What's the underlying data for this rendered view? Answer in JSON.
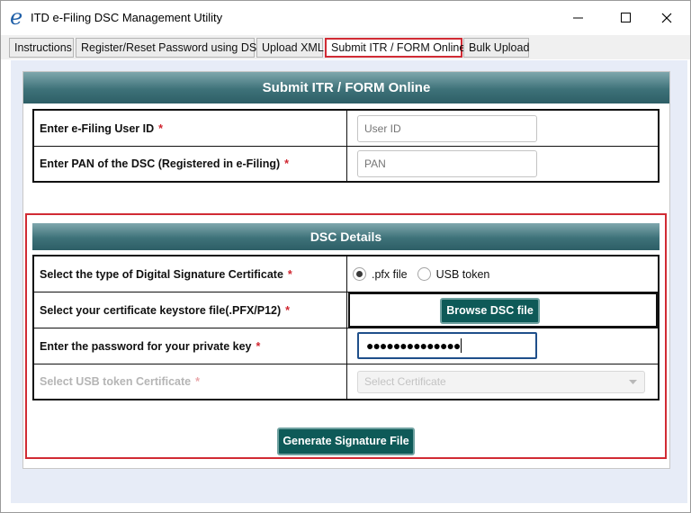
{
  "window": {
    "logo_letter": "e",
    "title": "ITD e-Filing DSC Management Utility"
  },
  "tabs": [
    {
      "label": "Instructions"
    },
    {
      "label": "Register/Reset Password using DSC"
    },
    {
      "label": "Upload XML"
    },
    {
      "label": "Submit ITR / FORM Online",
      "selected": true
    },
    {
      "label": "Bulk Upload"
    }
  ],
  "header": {
    "title": "Submit ITR / FORM Online"
  },
  "user_section": {
    "user_id": {
      "label": "Enter e-Filing User ID",
      "required_mark": "*",
      "placeholder": "User ID",
      "value": ""
    },
    "pan": {
      "label": "Enter PAN of the DSC (Registered in e-Filing)",
      "required_mark": "*",
      "placeholder": "PAN",
      "value": ""
    }
  },
  "dsc_section": {
    "title": "DSC Details",
    "cert_type": {
      "label": "Select the type of Digital Signature Certificate",
      "required_mark": "*",
      "options": [
        {
          "label": ".pfx file",
          "selected": true
        },
        {
          "label": "USB token",
          "selected": false
        }
      ]
    },
    "keystore": {
      "label": "Select your certificate keystore file(.PFX/P12)",
      "required_mark": "*",
      "button_label": "Browse DSC file"
    },
    "password": {
      "label": "Enter the password for your private key",
      "required_mark": "*",
      "masked_value": "●●●●●●●●●●●●●●"
    },
    "usb_cert": {
      "label": "Select USB token Certificate",
      "required_mark": "*",
      "placeholder": "Select Certificate",
      "disabled": true
    },
    "generate_button_label": "Generate Signature File"
  },
  "colors": {
    "header_teal": "#3e7279",
    "button_teal": "#0e5a58",
    "highlight_red": "#d12b34",
    "required_red": "#d0252f",
    "panel_bg": "#e7ecf7"
  },
  "icons": {
    "logo": "e-filing-logo-icon",
    "minimize": "minimize-icon",
    "maximize": "maximize-icon",
    "close": "close-icon",
    "dropdown": "chevron-down-icon"
  }
}
